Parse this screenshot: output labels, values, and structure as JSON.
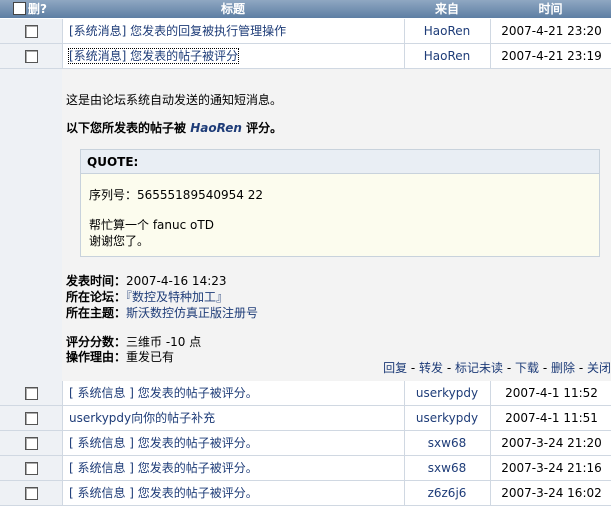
{
  "header": {
    "delete_label": "删?",
    "title_label": "标题",
    "from_label": "来自",
    "time_label": "时间"
  },
  "rows_top": [
    {
      "title": "[系统消息] 您发表的回复被执行管理操作",
      "from": "HaoRen",
      "time": "2007-4-21 23:20"
    },
    {
      "title": "[系统消息] 您发表的帖子被评分",
      "from": "HaoRen",
      "time": "2007-4-21 23:19"
    }
  ],
  "detail": {
    "notice": "这是由论坛系统自动发送的通知短消息。",
    "rating_prefix": "以下您所发表的帖子被",
    "rating_user": "HaoRen",
    "rating_suffix": "评分。",
    "quote_label": "QUOTE:",
    "quote_line1": "序列号：56555189540954 22",
    "quote_line2": "帮忙算一个 fanuc oTD",
    "quote_line3": "谢谢您了。",
    "post_time_label": "发表时间：",
    "post_time": "2007-4-16 14:23",
    "forum_label": "所在论坛：",
    "forum": "『数控及特种加工』",
    "topic_label": "所在主题：",
    "topic": "斯沃数控仿真正版注册号",
    "score_label": "评分分数：",
    "score": "三维币 -10 点",
    "reason_label": "操作理由：",
    "reason": "重发已有",
    "actions": [
      "回复",
      "转发",
      "标记未读",
      "下载",
      "删除",
      "关闭"
    ]
  },
  "rows_bottom": [
    {
      "title": "[ 系统信息 ] 您发表的帖子被评分。",
      "from": "userkypdy",
      "time": "2007-4-1 11:52"
    },
    {
      "title": "userkypdy向你的帖子补充",
      "from": "userkypdy",
      "time": "2007-4-1 11:51"
    },
    {
      "title": "[ 系统信息 ] 您发表的帖子被评分。",
      "from": "sxw68",
      "time": "2007-3-24 21:20"
    },
    {
      "title": "[ 系统信息 ] 您发表的帖子被评分。",
      "from": "sxw68",
      "time": "2007-3-24 21:16"
    },
    {
      "title": "[ 系统信息 ] 您发表的帖子被评分。",
      "from": "z6z6j6",
      "time": "2007-3-24 16:02"
    }
  ]
}
